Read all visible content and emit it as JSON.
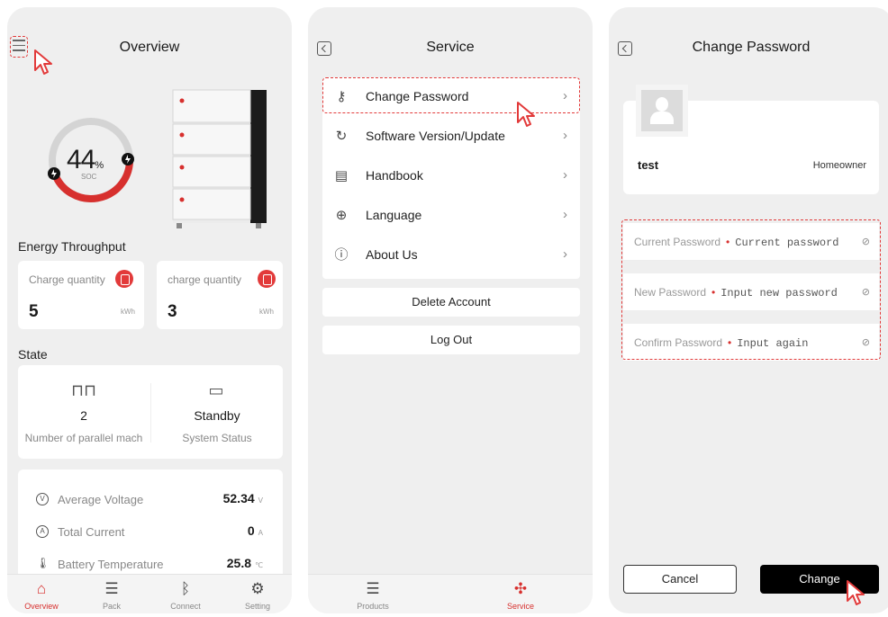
{
  "overview": {
    "title": "Overview",
    "soc": {
      "value": "44",
      "unit": "%",
      "label": "SOC",
      "fraction": 0.44
    },
    "energy_throughput": {
      "title": "Energy Throughput",
      "cards": [
        {
          "label": "Charge quantity",
          "value": "5",
          "unit": "kWh"
        },
        {
          "label": "charge quantity",
          "value": "3",
          "unit": "kWh"
        }
      ]
    },
    "state": {
      "title": "State",
      "items": [
        {
          "value": "2",
          "label": "Number of parallel mach",
          "icon": "parallel-icon"
        },
        {
          "value": "Standby",
          "label": "System Status",
          "icon": "monitor-icon"
        }
      ]
    },
    "metrics": [
      {
        "label": "Average Voltage",
        "value": "52.34",
        "unit": "V",
        "icon": "voltage-icon"
      },
      {
        "label": "Total Current",
        "value": "0",
        "unit": "A",
        "icon": "current-icon"
      },
      {
        "label": "Battery Temperature",
        "value": "25.8",
        "unit": "℃",
        "icon": "thermometer-icon"
      }
    ],
    "tabs": [
      {
        "label": "Overview",
        "active": true
      },
      {
        "label": "Pack",
        "active": false
      },
      {
        "label": "Connect",
        "active": false
      },
      {
        "label": "Setting",
        "active": false
      }
    ]
  },
  "service": {
    "title": "Service",
    "menu": [
      {
        "label": "Change Password",
        "icon": "key-icon"
      },
      {
        "label": "Software Version/Update",
        "icon": "refresh-icon"
      },
      {
        "label": "Handbook",
        "icon": "book-icon"
      },
      {
        "label": "Language",
        "icon": "globe-icon"
      },
      {
        "label": "About Us",
        "icon": "info-icon"
      }
    ],
    "delete_label": "Delete Account",
    "logout_label": "Log Out",
    "tabs": [
      {
        "label": "Products",
        "active": false
      },
      {
        "label": "Service",
        "active": true
      }
    ]
  },
  "change_password": {
    "title": "Change Password",
    "username": "test",
    "role": "Homeowner",
    "fields": [
      {
        "label": "Current Password",
        "placeholder": "Current password"
      },
      {
        "label": "New Password",
        "placeholder": "Input new password"
      },
      {
        "label": "Confirm Password",
        "placeholder": "Input again"
      }
    ],
    "cancel_label": "Cancel",
    "change_label": "Change"
  },
  "colors": {
    "accent": "#d7302e",
    "highlight": "#e23a3a",
    "background": "#efefef"
  }
}
